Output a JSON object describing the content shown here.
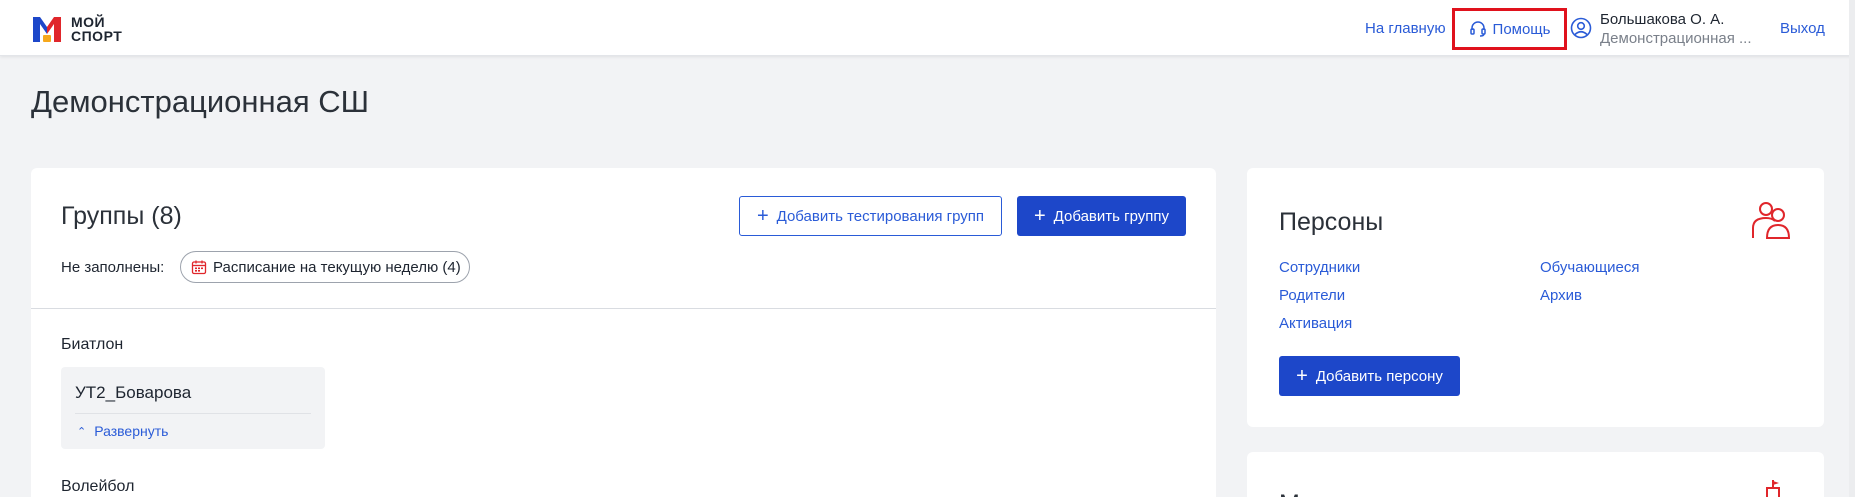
{
  "header": {
    "logo_line1": "МОЙ",
    "logo_line2": "СПОРТ",
    "nav_home": "На главную",
    "nav_help": "Помощь",
    "user_name": "Большакова О. А.",
    "user_org": "Демонстрационная ...",
    "logout": "Выход"
  },
  "page": {
    "title": "Демонстрационная СШ"
  },
  "groups": {
    "title": "Группы (8)",
    "add_testing_label": "Добавить тестирования групп",
    "add_group_label": "Добавить группу",
    "unfilled_label": "Не заполнены:",
    "schedule_chip": "Расписание на текущую неделю (4)",
    "sports": [
      {
        "name": "Биатлон",
        "groups": [
          {
            "name": "УТ2_Боварова",
            "expand_label": "Развернуть"
          }
        ]
      },
      {
        "name": "Волейбол"
      }
    ]
  },
  "persons": {
    "title": "Персоны",
    "links": {
      "staff": "Сотрудники",
      "students": "Обучающиеся",
      "parents": "Родители",
      "archive": "Архив",
      "activation": "Активация"
    },
    "add_person_label": "Добавить персону"
  },
  "second_card": {
    "title_fragment": "М"
  },
  "colors": {
    "accent": "#2a5bd7",
    "primary_button": "#1d47c9",
    "highlight_red": "#e0121d",
    "icon_red": "#e0262b",
    "background": "#f2f3f5"
  }
}
